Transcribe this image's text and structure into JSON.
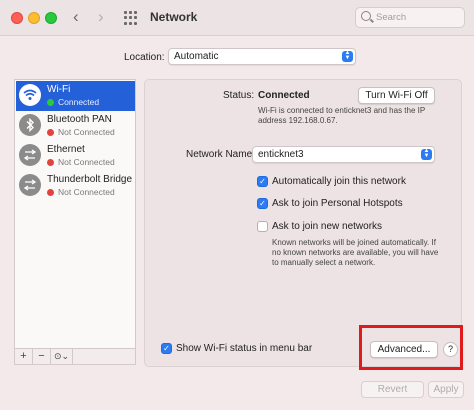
{
  "window": {
    "title": "Network",
    "search_placeholder": "Search"
  },
  "location": {
    "label": "Location:",
    "value": "Automatic"
  },
  "services": [
    {
      "name": "Wi-Fi",
      "status": "Connected",
      "status_color": "#2bc840",
      "icon": "wifi-icon",
      "selected": true
    },
    {
      "name": "Bluetooth PAN",
      "status": "Not Connected",
      "status_color": "#e0443e",
      "icon": "bluetooth-icon",
      "selected": false
    },
    {
      "name": "Ethernet",
      "status": "Not Connected",
      "status_color": "#e0443e",
      "icon": "ethernet-icon",
      "selected": false
    },
    {
      "name": "Thunderbolt Bridge",
      "status": "Not Connected",
      "status_color": "#e0443e",
      "icon": "thunderbolt-icon",
      "selected": false
    }
  ],
  "sidebar_tools": {
    "add": "+",
    "remove": "−",
    "action": "⊙⌄"
  },
  "detail": {
    "status_label": "Status:",
    "status_value": "Connected",
    "toggle_button": "Turn Wi-Fi Off",
    "status_description": "Wi-Fi is connected to enticknet3 and has the IP address 192.168.0.67.",
    "network_name_label": "Network Name:",
    "network_name_value": "enticknet3",
    "options": [
      {
        "label": "Automatically join this network",
        "checked": true
      },
      {
        "label": "Ask to join Personal Hotspots",
        "checked": true
      },
      {
        "label": "Ask to join new networks",
        "checked": false
      }
    ],
    "known_networks_note": "Known networks will be joined automatically. If no known networks are available, you will have to manually select a network.",
    "menu_bar_option": {
      "label": "Show Wi-Fi status in menu bar",
      "checked": true
    },
    "advanced_button": "Advanced...",
    "help_button": "?"
  },
  "footer": {
    "revert": "Revert",
    "apply": "Apply"
  },
  "accent_color": "#2b7bf3",
  "highlight_color": "#e11b1b"
}
